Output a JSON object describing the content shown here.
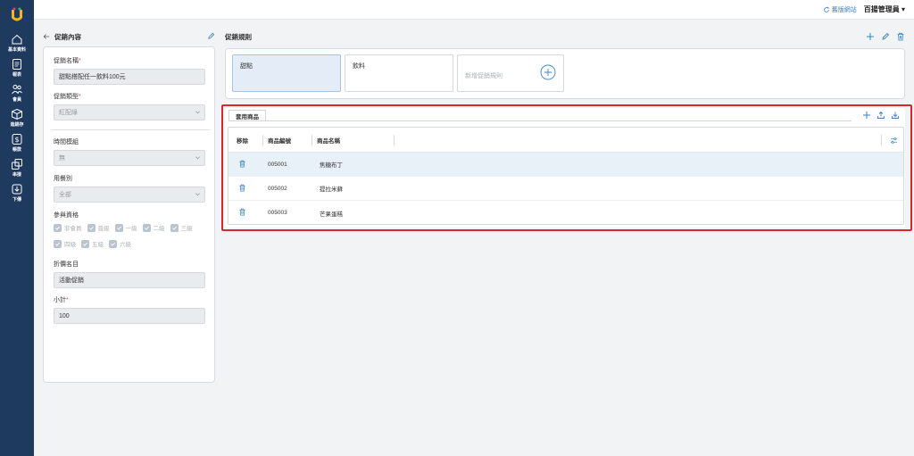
{
  "colors": {
    "sidebar": "#1f3a5f",
    "accent": "#3b82c4",
    "highlight": "#d7262e"
  },
  "sidebar": {
    "items": [
      {
        "icon": "home-icon",
        "label": "基本資料"
      },
      {
        "icon": "report-icon",
        "label": "報表"
      },
      {
        "icon": "members-icon",
        "label": "會員"
      },
      {
        "icon": "inventory-box-icon",
        "label": "進銷存"
      },
      {
        "icon": "dollar-icon",
        "label": "帳款"
      },
      {
        "icon": "connect-icon",
        "label": "串接"
      },
      {
        "icon": "download-icon",
        "label": "下傳"
      }
    ]
  },
  "topbar": {
    "old_site": "舊版網站",
    "user": "百揚管理員"
  },
  "left": {
    "header": "促銷內容",
    "name_label": "促銷名稱",
    "name_value": "甜點搭配任一飲料100元",
    "type_label": "促銷類型",
    "type_value": "紅配綠",
    "time_label": "時間模組",
    "time_value": "無",
    "meal_label": "用餐別",
    "meal_value": "全部",
    "qual_label": "參與資格",
    "qualifications": [
      "非會員",
      "普級",
      "一級",
      "二級",
      "三級",
      "四級",
      "五級",
      "六級"
    ],
    "discount_label": "折價名目",
    "discount_value": "活動促銷",
    "subtotal_label": "小計",
    "subtotal_value": "100"
  },
  "rules": {
    "header": "促銷規則",
    "items": [
      "甜點",
      "飲料"
    ],
    "add_label": "新增促銷規則"
  },
  "products": {
    "tab": "套用商品",
    "columns": {
      "remove": "移除",
      "code": "商品編號",
      "name": "商品名稱"
    },
    "rows": [
      {
        "code": "005001",
        "name": "焦糖布丁"
      },
      {
        "code": "005002",
        "name": "提拉米蘇"
      },
      {
        "code": "005003",
        "name": "芒果蛋糕"
      }
    ]
  }
}
